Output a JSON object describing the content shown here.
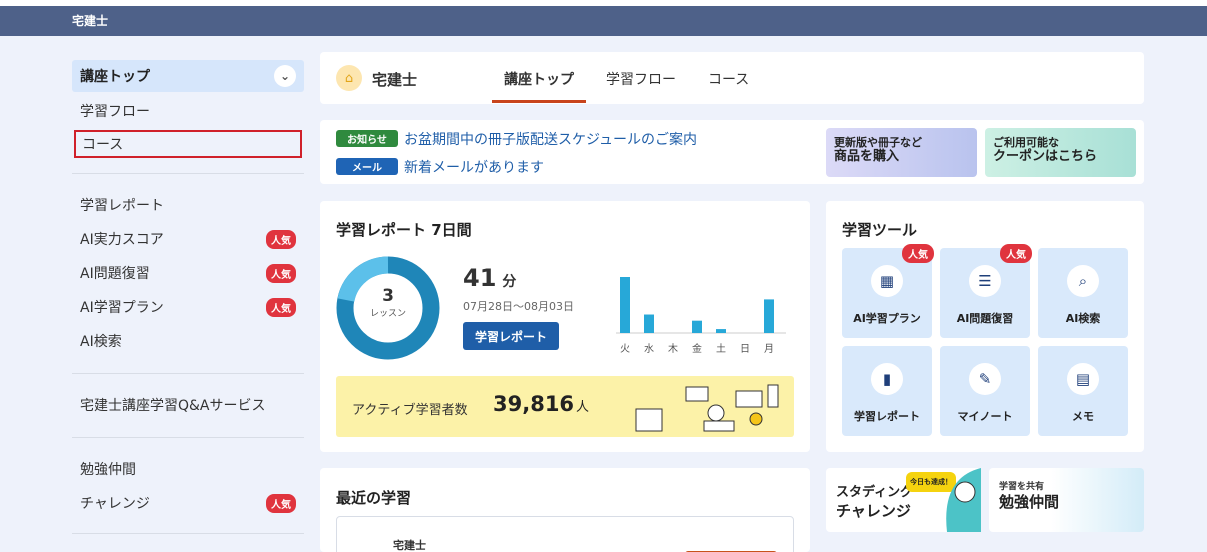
{
  "header": {
    "app_title": "宅建士"
  },
  "sidebar": {
    "top_item": "講座トップ",
    "group1": [
      {
        "label": "学習フロー"
      },
      {
        "label": "コース"
      }
    ],
    "group2": [
      {
        "label": "学習レポート",
        "badge": ""
      },
      {
        "label": "AI実力スコア",
        "badge": "人気"
      },
      {
        "label": "AI問題復習",
        "badge": "人気"
      },
      {
        "label": "AI学習プラン",
        "badge": "人気"
      },
      {
        "label": "AI検索",
        "badge": ""
      }
    ],
    "group3": [
      {
        "label": "宅建士講座学習Q&Aサービス"
      }
    ],
    "group4": [
      {
        "label": "勉強仲間",
        "badge": ""
      },
      {
        "label": "チャレンジ",
        "badge": "人気"
      }
    ]
  },
  "course_header": {
    "title": "宅建士",
    "tabs": [
      "講座トップ",
      "学習フロー",
      "コース"
    ],
    "active_tab": "講座トップ"
  },
  "notices": [
    {
      "tag": "お知らせ",
      "tag_color": "#2f8a3e",
      "text": "お盆期間中の冊子版配送スケジュールのご案内"
    },
    {
      "tag": "メール",
      "tag_color": "#1f64b5",
      "text": "新着メールがあります"
    }
  ],
  "promos": [
    {
      "small": "更新版や冊子など",
      "big": "商品を購入"
    },
    {
      "small": "ご利用可能な",
      "big": "クーポンはこちら"
    }
  ],
  "report": {
    "title": "学習レポート 7日間",
    "lessons": "3",
    "lessons_unit": "レッスン",
    "minutes": "41",
    "minutes_unit": "分",
    "range": "07月28日〜08月03日",
    "button": "学習レポート",
    "chart_days": [
      "火",
      "水",
      "木",
      "金",
      "土",
      "日",
      "月"
    ],
    "chart_values": [
      1.0,
      0.33,
      0,
      0.22,
      0.07,
      0,
      0.6
    ],
    "active_label": "アクティブ学習者数",
    "active_count": "39,816",
    "active_unit": "人"
  },
  "tools": {
    "title": "学習ツール",
    "items": [
      {
        "label": "AI学習プラン",
        "icon": "calendar-check-icon",
        "badge": "人気"
      },
      {
        "label": "AI問題復習",
        "icon": "document-review-icon",
        "badge": "人気"
      },
      {
        "label": "AI検索",
        "icon": "search-icon",
        "badge": ""
      },
      {
        "label": "学習レポート",
        "icon": "bar-chart-icon",
        "badge": ""
      },
      {
        "label": "マイノート",
        "icon": "pencil-note-icon",
        "badge": ""
      },
      {
        "label": "メモ",
        "icon": "memo-icon",
        "badge": ""
      }
    ]
  },
  "recent": {
    "title": "最近の学習",
    "course": "宅建士"
  },
  "banners": [
    {
      "tag": "今日も達成！",
      "line1": "スタディング",
      "line2": "チャレンジ"
    },
    {
      "small": "学習を共有",
      "big": "勉強仲間"
    }
  ]
}
